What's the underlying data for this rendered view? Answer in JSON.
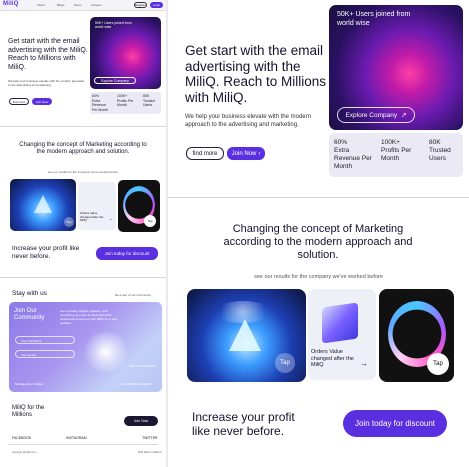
{
  "brand": {
    "logo": "MiliQ",
    "accent": "#5a2fe0"
  },
  "nav": {
    "items": [
      "About",
      "Blogs",
      "Team",
      "Careers"
    ],
    "register": "Register",
    "login": "Login"
  },
  "hero": {
    "title": "Get start with the email advertising with the MiliQ. Reach to Millions with MiliQ.",
    "subtitle": "We help your business elevate with the modern approach to the advertising and marketing.",
    "find_more": "find more",
    "join_now": "Join Now",
    "card_text": "50K+ Users joined from world wise",
    "explore": "Explore Company",
    "stats": [
      {
        "value": "60%",
        "label": "Extra Revenue Per Month"
      },
      {
        "value": "100K+",
        "label": "Profits Per Month"
      },
      {
        "value": "80K",
        "label": "Trusted Users"
      }
    ]
  },
  "concept": {
    "title": "Changing the concept of Marketing according to the modern approach and solution.",
    "subtitle": "see our results for the company we've worked before",
    "tap": "Tap",
    "orders_text": "Orders Value changed after the MiliQ"
  },
  "profit": {
    "title": "Increase your profit like never before.",
    "cta": "Join today for discount"
  },
  "stay": {
    "title": "Stay with us",
    "side": "Be a part of our community",
    "community_title": "Join Our Community",
    "community_text": "Get a weekly insights, updates, and everything you need to know about the businesses to keep up with MiliQ so to stay updated",
    "name_placeholder": "Your Full Name",
    "email_placeholder": "Your Email",
    "foot_left": "Managed from Miliqs",
    "foot_users": "100+ Joined Already",
    "foot_right": "100+ JOINED ALREADY"
  },
  "footer": {
    "brand_title": "MiliQ for the Millions",
    "join_now": "Join Now",
    "socials": [
      "FACEBOOK",
      "INSTAGRAM",
      "TWITTER"
    ],
    "copyright": "copyright @miliq.co.in",
    "credit": "Bold Made in Millions"
  }
}
